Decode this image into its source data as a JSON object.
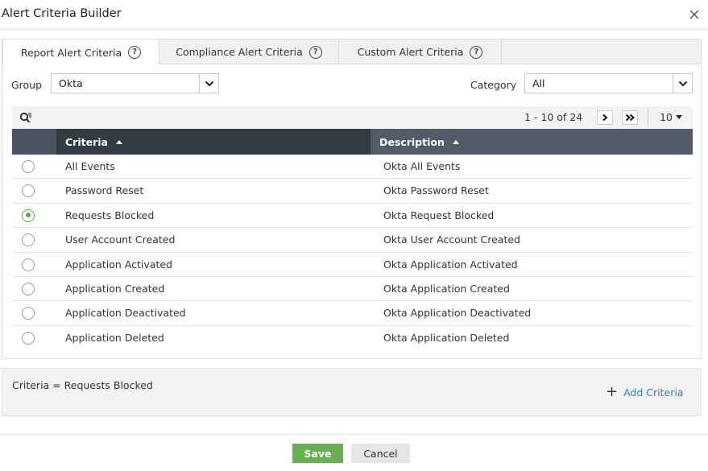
{
  "dialog": {
    "title": "Alert Criteria Builder",
    "close_icon": "close-icon"
  },
  "tabs": [
    {
      "label": "Report Alert Criteria",
      "active": true,
      "icon": "help-icon"
    },
    {
      "label": "Compliance Alert Criteria",
      "active": false,
      "icon": "help-icon"
    },
    {
      "label": "Custom Alert Criteria",
      "active": false,
      "icon": "help-icon"
    }
  ],
  "filters": {
    "group_label": "Group",
    "group_value": "Okta",
    "category_label": "Category",
    "category_value": "All"
  },
  "toolbar": {
    "search_icon": "search-filter-icon",
    "page_range": "1 - 10 of 24",
    "next_icon": "chevron-right-icon",
    "last_icon": "double-chevron-right-icon",
    "per_page": "10"
  },
  "table": {
    "columns": [
      "Criteria",
      "Description"
    ],
    "rows": [
      {
        "criteria": "All Events",
        "description": "Okta All Events",
        "selected": false
      },
      {
        "criteria": "Password Reset",
        "description": "Okta Password Reset",
        "selected": false
      },
      {
        "criteria": "Requests Blocked",
        "description": "Okta Request Blocked",
        "selected": true
      },
      {
        "criteria": "User Account Created",
        "description": "Okta User Account Created",
        "selected": false
      },
      {
        "criteria": "Application Activated",
        "description": "Okta Application Activated",
        "selected": false
      },
      {
        "criteria": "Application Created",
        "description": "Okta Application Created",
        "selected": false
      },
      {
        "criteria": "Application Deactivated",
        "description": "Okta Application Deactivated",
        "selected": false
      },
      {
        "criteria": "Application Deleted",
        "description": "Okta Application Deleted",
        "selected": false
      }
    ]
  },
  "summary": {
    "criteria_text": "Criteria = Requests Blocked",
    "add_label": "Add Criteria"
  },
  "footer": {
    "save_label": "Save",
    "cancel_label": "Cancel"
  },
  "colors": {
    "accent_green": "#68b04f",
    "link_blue": "#2f7fc1",
    "header_dark": "#333b43"
  }
}
